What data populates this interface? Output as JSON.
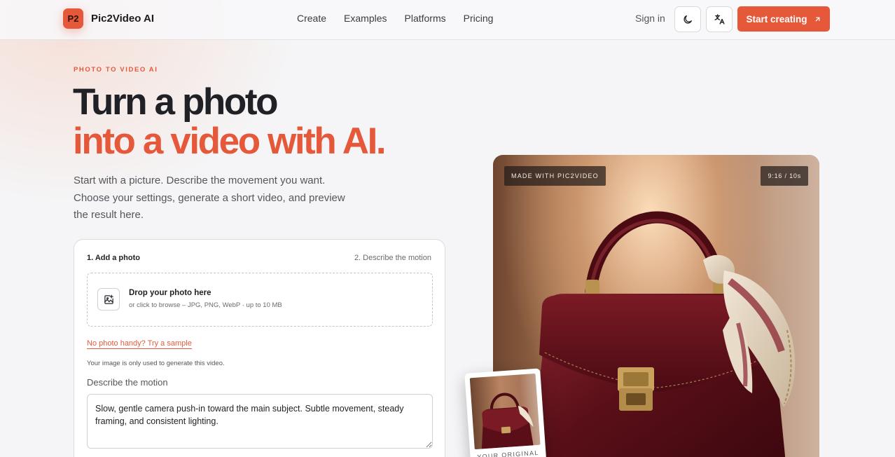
{
  "brand": {
    "logo_text": "P2",
    "name": "Pic2Video AI",
    "accent": "#e5593a"
  },
  "nav": {
    "items": [
      "Create",
      "Examples",
      "Platforms",
      "Pricing"
    ]
  },
  "header": {
    "sign_in": "Sign in",
    "theme_icon": "moon-icon",
    "language_icon": "translate-icon",
    "cta_label": "Start creating",
    "cta_icon": "arrow-up-right-icon"
  },
  "hero": {
    "eyebrow": "PHOTO TO VIDEO AI",
    "title_line1": "Turn a photo",
    "title_line2": "into a video with AI.",
    "lead": "Start with a picture. Describe the movement you want. Choose your settings, generate a short video, and preview the result here."
  },
  "form": {
    "step1": "1. Add a photo",
    "step2": "2. Describe the motion",
    "dropzone_icon": "image-plus-icon",
    "dropzone_title": "Drop your photo here",
    "dropzone_subtitle": "or click to browse – JPG, PNG, WebP · up to 10 MB",
    "sample_link": "No photo handy? Try a sample",
    "privacy_note": "Your image is only used to generate this video.",
    "motion_label": "Describe the motion",
    "motion_value": "Slow, gentle camera push-in toward the main subject. Subtle movement, steady framing, and consistent lighting."
  },
  "preview": {
    "badge_made": "MADE WITH PIC2VIDEO",
    "badge_meta": "9:16 / 10s",
    "thumb_label": "YOUR ORIGINAL"
  }
}
